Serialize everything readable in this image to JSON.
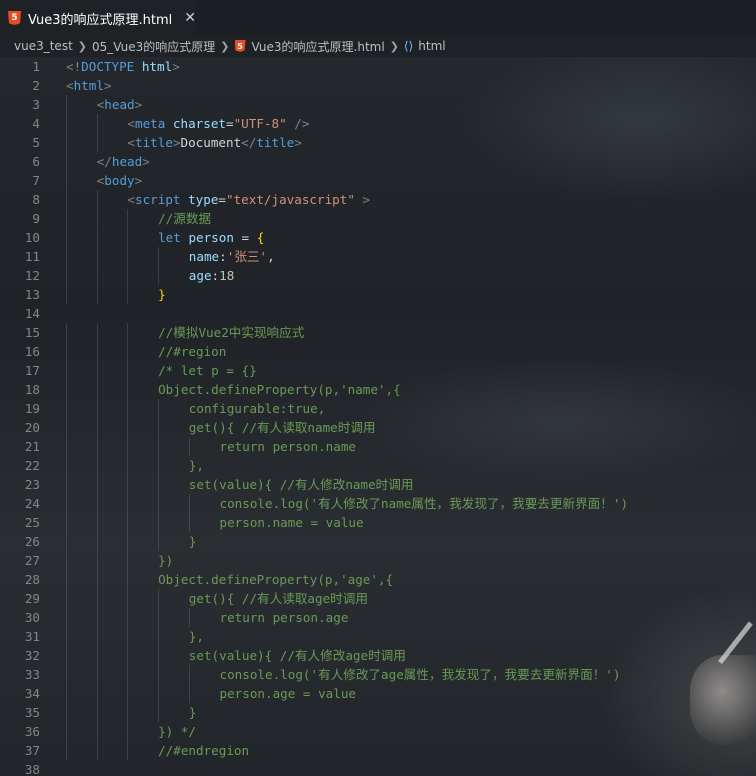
{
  "tab": {
    "icon": "html5-icon",
    "label": "Vue3的响应式原理.html",
    "close": "✕"
  },
  "breadcrumb": {
    "items": [
      "vue3_test",
      "05_Vue3的响应式原理",
      "Vue3的响应式原理.html",
      "html"
    ]
  },
  "code_lines": [
    {
      "n": "1",
      "indent": 0,
      "tokens": [
        [
          "br",
          "<!"
        ],
        [
          "tag",
          "DOCTYPE"
        ],
        [
          "txt",
          " "
        ],
        [
          "attr",
          "html"
        ],
        [
          "br",
          ">"
        ]
      ]
    },
    {
      "n": "2",
      "indent": 0,
      "tokens": [
        [
          "br",
          "<"
        ],
        [
          "tag",
          "html"
        ],
        [
          "br",
          ">"
        ]
      ]
    },
    {
      "n": "3",
      "indent": 1,
      "tokens": [
        [
          "br",
          "<"
        ],
        [
          "tag",
          "head"
        ],
        [
          "br",
          ">"
        ]
      ]
    },
    {
      "n": "4",
      "indent": 2,
      "tokens": [
        [
          "br",
          "<"
        ],
        [
          "tag",
          "meta"
        ],
        [
          "txt",
          " "
        ],
        [
          "attr",
          "charset"
        ],
        [
          "pl",
          "="
        ],
        [
          "str",
          "\"UTF-8\""
        ],
        [
          "txt",
          " "
        ],
        [
          "br",
          "/>"
        ]
      ]
    },
    {
      "n": "5",
      "indent": 2,
      "tokens": [
        [
          "br",
          "<"
        ],
        [
          "tag",
          "title"
        ],
        [
          "br",
          ">"
        ],
        [
          "txt",
          "Document"
        ],
        [
          "br",
          "</"
        ],
        [
          "tag",
          "title"
        ],
        [
          "br",
          ">"
        ]
      ]
    },
    {
      "n": "6",
      "indent": 1,
      "tokens": [
        [
          "br",
          "</"
        ],
        [
          "tag",
          "head"
        ],
        [
          "br",
          ">"
        ]
      ]
    },
    {
      "n": "7",
      "indent": 1,
      "tokens": [
        [
          "br",
          "<"
        ],
        [
          "tag",
          "body"
        ],
        [
          "br",
          ">"
        ]
      ]
    },
    {
      "n": "8",
      "indent": 2,
      "tokens": [
        [
          "br",
          "<"
        ],
        [
          "tag",
          "script"
        ],
        [
          "txt",
          " "
        ],
        [
          "attr",
          "type"
        ],
        [
          "pl",
          "="
        ],
        [
          "str",
          "\"text/javascript\""
        ],
        [
          "txt",
          " "
        ],
        [
          "br",
          ">"
        ]
      ]
    },
    {
      "n": "9",
      "indent": 3,
      "tokens": [
        [
          "com",
          "//源数据"
        ]
      ]
    },
    {
      "n": "10",
      "indent": 3,
      "tokens": [
        [
          "kw",
          "let"
        ],
        [
          "txt",
          " "
        ],
        [
          "var",
          "person"
        ],
        [
          "pl",
          " = "
        ],
        [
          "brace",
          "{"
        ]
      ]
    },
    {
      "n": "11",
      "indent": 4,
      "tokens": [
        [
          "var",
          "name"
        ],
        [
          "pl",
          ":"
        ],
        [
          "str",
          "'张三'"
        ],
        [
          "pl",
          ","
        ]
      ]
    },
    {
      "n": "12",
      "indent": 4,
      "tokens": [
        [
          "var",
          "age"
        ],
        [
          "pl",
          ":"
        ],
        [
          "num",
          "18"
        ]
      ]
    },
    {
      "n": "13",
      "indent": 3,
      "tokens": [
        [
          "brace",
          "}"
        ]
      ]
    },
    {
      "n": "14",
      "indent": 0,
      "tokens": []
    },
    {
      "n": "15",
      "indent": 3,
      "tokens": [
        [
          "com",
          "//模拟Vue2中实现响应式"
        ]
      ]
    },
    {
      "n": "16",
      "indent": 3,
      "tokens": [
        [
          "com",
          "//#region"
        ]
      ]
    },
    {
      "n": "17",
      "indent": 3,
      "tokens": [
        [
          "com",
          "/* let p = {}"
        ]
      ]
    },
    {
      "n": "18",
      "indent": 3,
      "tokens": [
        [
          "com",
          "Object.defineProperty(p,'name',{"
        ]
      ]
    },
    {
      "n": "19",
      "indent": 4,
      "tokens": [
        [
          "com",
          "configurable:true,"
        ]
      ]
    },
    {
      "n": "20",
      "indent": 4,
      "tokens": [
        [
          "com",
          "get(){ //有人读取name时调用"
        ]
      ]
    },
    {
      "n": "21",
      "indent": 5,
      "tokens": [
        [
          "com",
          "return person.name"
        ]
      ]
    },
    {
      "n": "22",
      "indent": 4,
      "tokens": [
        [
          "com",
          "},"
        ]
      ]
    },
    {
      "n": "23",
      "indent": 4,
      "tokens": [
        [
          "com",
          "set(value){ //有人修改name时调用"
        ]
      ]
    },
    {
      "n": "24",
      "indent": 5,
      "tokens": [
        [
          "com",
          "console.log('有人修改了name属性，我发现了，我要去更新界面！')"
        ]
      ]
    },
    {
      "n": "25",
      "indent": 5,
      "tokens": [
        [
          "com",
          "person.name = value"
        ]
      ]
    },
    {
      "n": "26",
      "indent": 4,
      "tokens": [
        [
          "com",
          "}"
        ]
      ]
    },
    {
      "n": "27",
      "indent": 3,
      "tokens": [
        [
          "com",
          "})"
        ]
      ]
    },
    {
      "n": "28",
      "indent": 3,
      "tokens": [
        [
          "com",
          "Object.defineProperty(p,'age',{"
        ]
      ]
    },
    {
      "n": "29",
      "indent": 4,
      "tokens": [
        [
          "com",
          "get(){ //有人读取age时调用"
        ]
      ]
    },
    {
      "n": "30",
      "indent": 5,
      "tokens": [
        [
          "com",
          "return person.age"
        ]
      ]
    },
    {
      "n": "31",
      "indent": 4,
      "tokens": [
        [
          "com",
          "},"
        ]
      ]
    },
    {
      "n": "32",
      "indent": 4,
      "tokens": [
        [
          "com",
          "set(value){ //有人修改age时调用"
        ]
      ]
    },
    {
      "n": "33",
      "indent": 5,
      "tokens": [
        [
          "com",
          "console.log('有人修改了age属性，我发现了，我要去更新界面！')"
        ]
      ]
    },
    {
      "n": "34",
      "indent": 5,
      "tokens": [
        [
          "com",
          "person.age = value"
        ]
      ]
    },
    {
      "n": "35",
      "indent": 4,
      "tokens": [
        [
          "com",
          "}"
        ]
      ]
    },
    {
      "n": "36",
      "indent": 3,
      "tokens": [
        [
          "com",
          "}) */"
        ]
      ]
    },
    {
      "n": "37",
      "indent": 3,
      "tokens": [
        [
          "com",
          "//#endregion"
        ]
      ]
    },
    {
      "n": "38",
      "indent": 0,
      "tokens": []
    }
  ]
}
